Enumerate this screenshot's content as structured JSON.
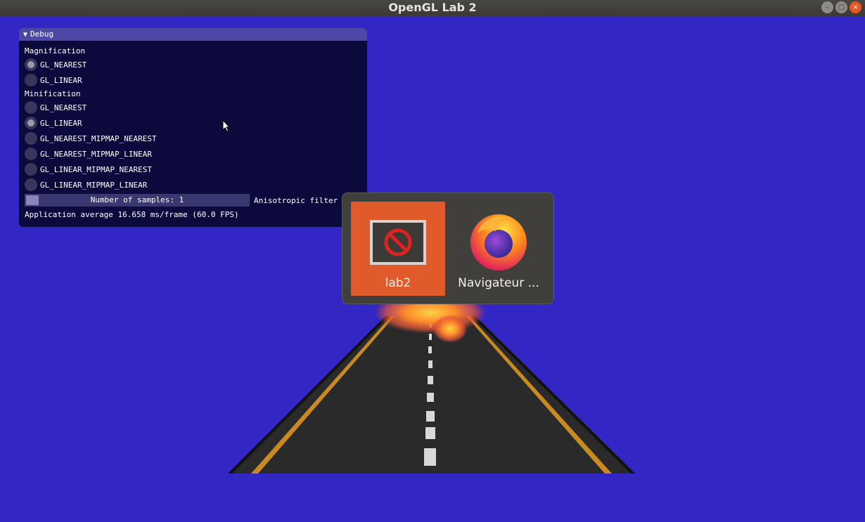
{
  "window": {
    "title": "OpenGL Lab 2"
  },
  "debug": {
    "header": "Debug",
    "magnification_label": "Magnification",
    "magnification_options": [
      {
        "label": "GL_NEAREST",
        "selected": true
      },
      {
        "label": "GL_LINEAR",
        "selected": false
      }
    ],
    "minification_label": "Minification",
    "minification_options": [
      {
        "label": "GL_NEAREST",
        "selected": false
      },
      {
        "label": "GL_LINEAR",
        "selected": true
      },
      {
        "label": "GL_NEAREST_MIPMAP_NEAREST",
        "selected": false
      },
      {
        "label": "GL_NEAREST_MIPMAP_LINEAR",
        "selected": false
      },
      {
        "label": "GL_LINEAR_MIPMAP_NEAREST",
        "selected": false
      },
      {
        "label": "GL_LINEAR_MIPMAP_LINEAR",
        "selected": false
      }
    ],
    "samples_slider": "Number of samples: 1",
    "samples_value": 1,
    "anisotropic_label": "Anisotropic filter",
    "fps_text": "Application average 16.658 ms/frame (60.0 FPS)"
  },
  "switcher": {
    "apps": [
      {
        "label": "lab2",
        "icon": "unavailable-app-icon",
        "selected": true
      },
      {
        "label": "Navigateur ...",
        "icon": "firefox-icon",
        "selected": false
      }
    ]
  },
  "colors": {
    "background": "#3227c4",
    "panel": "#0c0a3d",
    "panel_header": "#4d47a6",
    "accent": "#e05a2b"
  }
}
